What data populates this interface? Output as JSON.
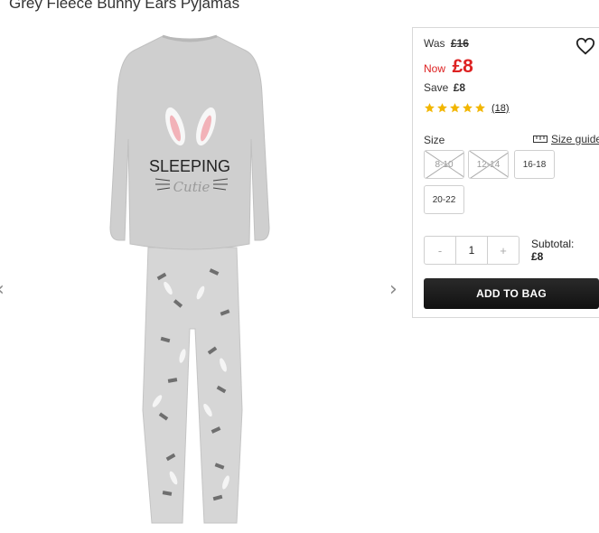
{
  "product": {
    "title": "Grey Fleece Bunny Ears Pyjamas",
    "image_alt": "Grey fleece bunny ears pyjama set",
    "sweatshirt_text_1": "SLEEPING",
    "sweatshirt_text_2": "Cutie"
  },
  "gallery": {
    "prev_icon": "‹",
    "next_icon": "›"
  },
  "pricing": {
    "was_label": "Was",
    "was_price": "£16",
    "now_label": "Now",
    "now_price": "£8",
    "save_label": "Save",
    "save_amount": "£8",
    "price_color": "#dd2222"
  },
  "rating": {
    "stars": 5,
    "count_text": "(18)",
    "star_color": "#f2b600"
  },
  "size": {
    "label": "Size",
    "guide_label": "Size guide",
    "options": [
      {
        "label": "8-10",
        "available": false
      },
      {
        "label": "12-14",
        "available": false
      },
      {
        "label": "16-18",
        "available": true
      },
      {
        "label": "20-22",
        "available": true
      }
    ]
  },
  "quantity": {
    "minus": "-",
    "value": "1",
    "plus": "+"
  },
  "subtotal": {
    "label": "Subtotal:",
    "value": "£8"
  },
  "actions": {
    "add_to_bag": "ADD TO BAG"
  }
}
